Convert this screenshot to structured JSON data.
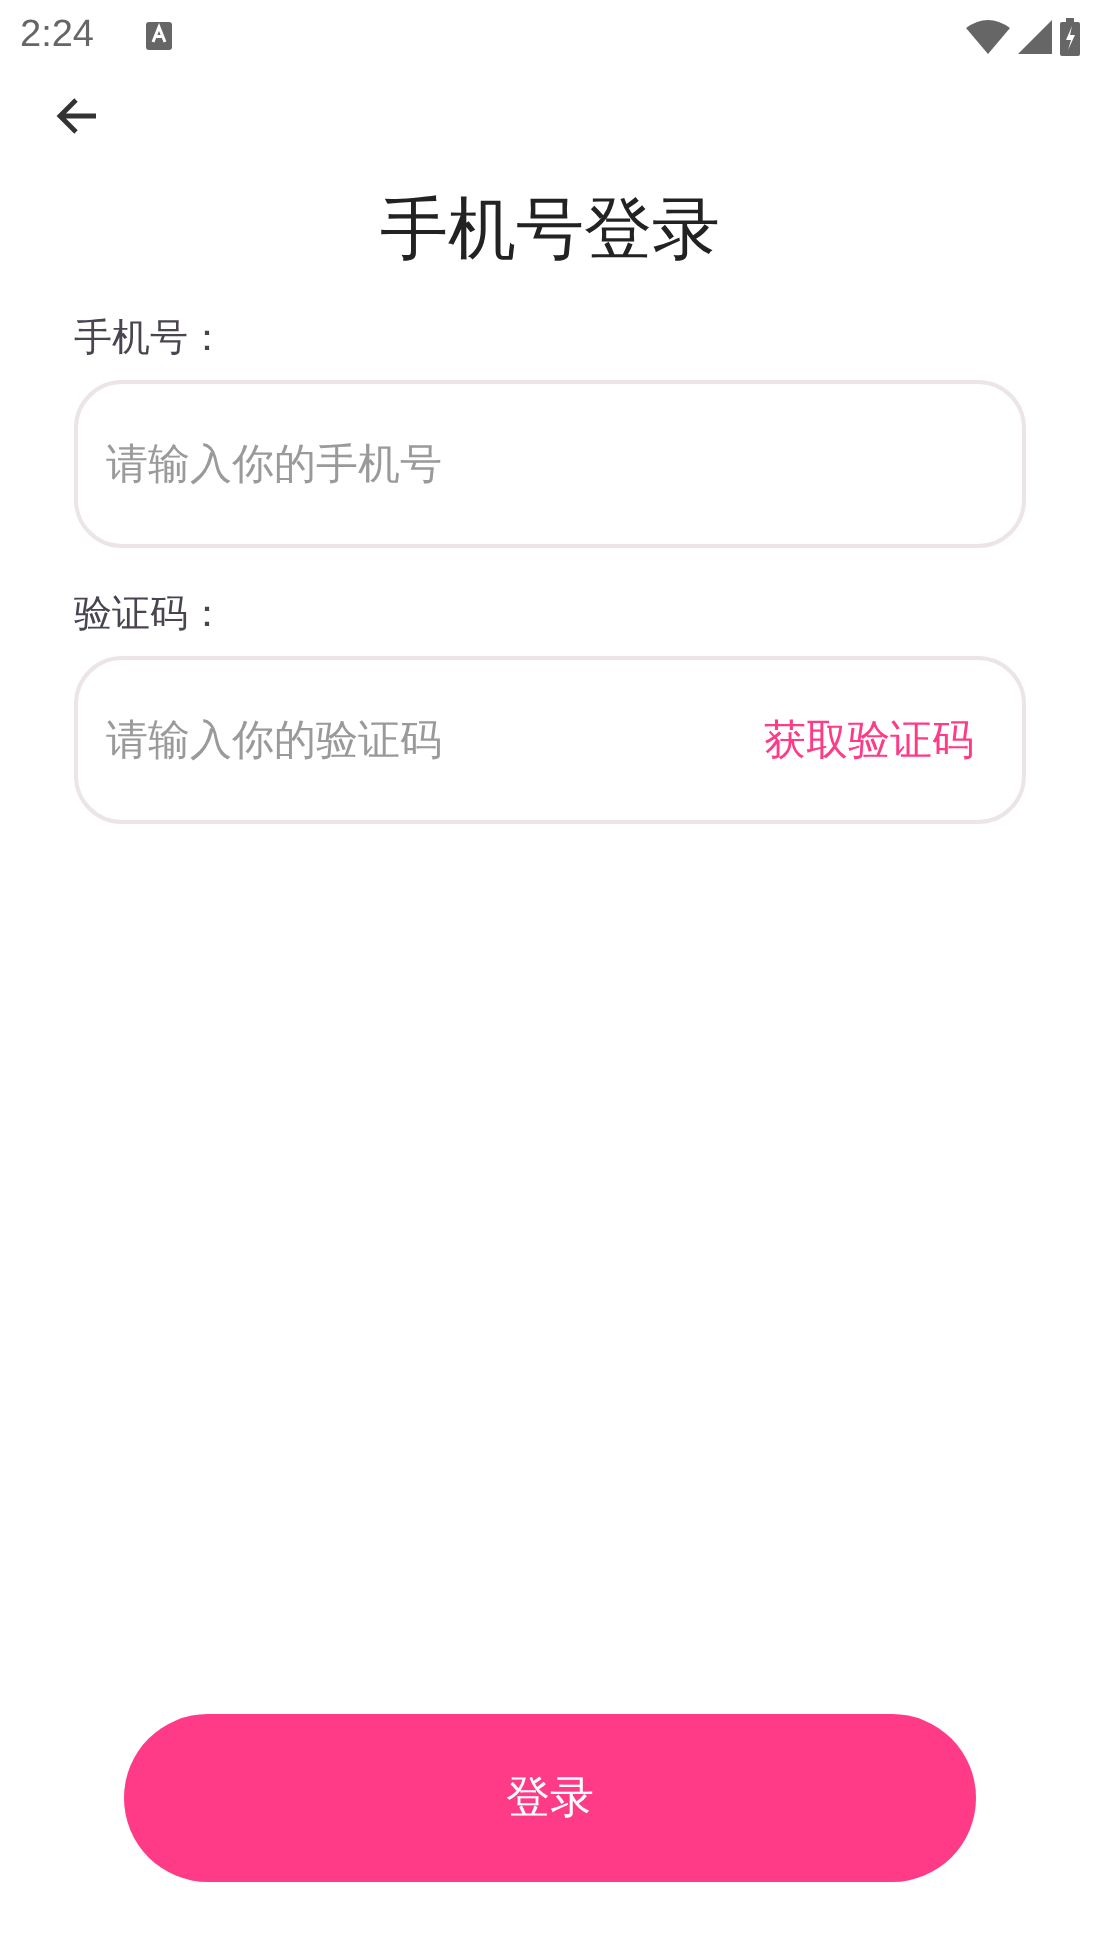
{
  "status_bar": {
    "time": "2:24"
  },
  "title": "手机号登录",
  "fields": [
    {
      "label": "手机号：",
      "placeholder": "请输入你的手机号"
    },
    {
      "label": "验证码：",
      "placeholder": "请输入你的验证码",
      "action": "获取验证码"
    }
  ],
  "submit": "登录"
}
